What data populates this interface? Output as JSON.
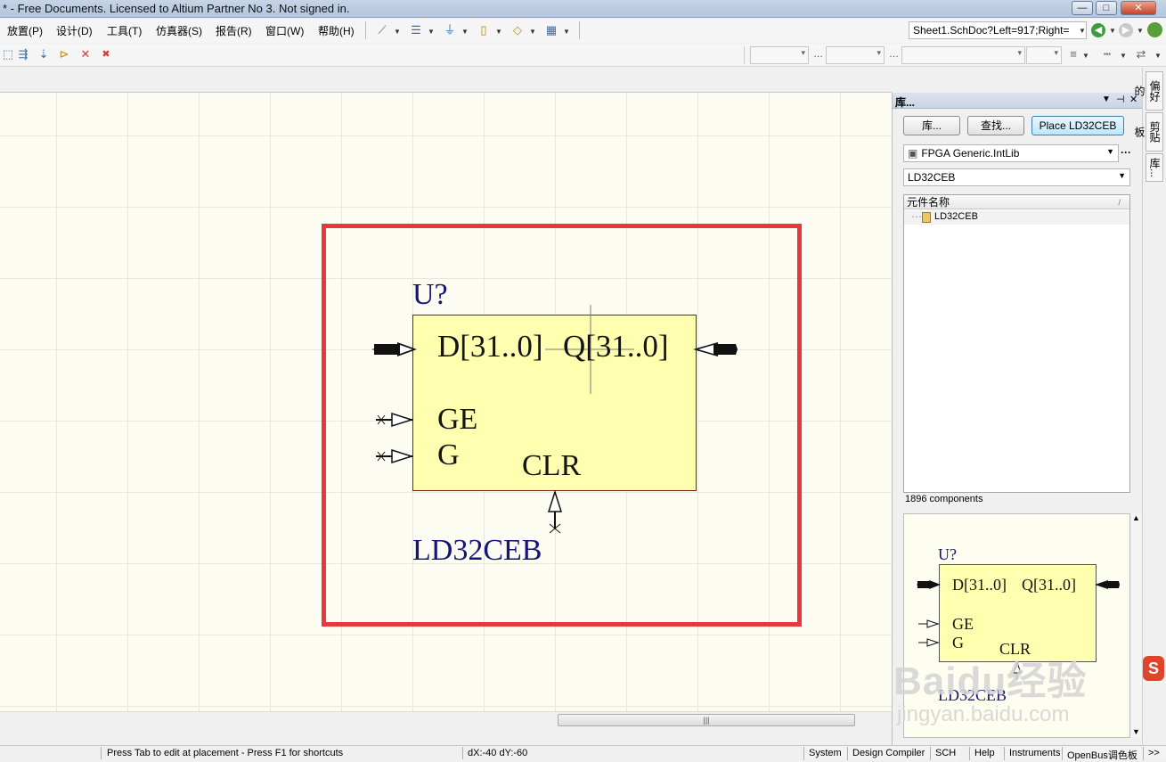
{
  "window": {
    "title": "* - Free Documents. Licensed to Altium Partner No 3. Not signed in.",
    "controls": {
      "minimize": "—",
      "maximize": "□",
      "close": "✕"
    }
  },
  "menu": {
    "items": [
      "放置(P)",
      "设计(D)",
      "工具(T)",
      "仿真器(S)",
      "报告(R)",
      "窗口(W)",
      "帮助(H)"
    ]
  },
  "navigation": {
    "location": "Sheet1.SchDoc?Left=917;Right="
  },
  "schematic": {
    "designator": "U?",
    "comment": "LD32CEB",
    "pins": {
      "d": "D[31..0]",
      "q": "Q[31..0]",
      "ge": "GE",
      "g": "G",
      "clr": "CLR"
    },
    "colors": {
      "body_fill": "#ffffb0",
      "body_border": "#7a1f1f",
      "highlight_frame": "#e8383d",
      "sheet_background": "#fdfcf3"
    }
  },
  "panel": {
    "title": "库...",
    "buttons": {
      "libraries": "库...",
      "search": "查找...",
      "place": "Place LD32CEB"
    },
    "library_name": "FPGA Generic.IntLib",
    "filter_value": "LD32CEB",
    "column_header": "元件名称",
    "components": [
      "LD32CEB"
    ],
    "count_text": "1896 components"
  },
  "side_tabs": [
    "偏好的",
    "剪贴板",
    "库..."
  ],
  "statusbar": {
    "message": "Press Tab to edit at placement - Press F1 for shortcuts",
    "coords": "dX:-40 dY:-60",
    "buttons": [
      "System",
      "Design Compiler",
      "SCH",
      "Help",
      "Instruments",
      "OpenBus调色板"
    ],
    "more": ">>"
  },
  "watermark": {
    "brand": "Baidu经验",
    "url": "jingyan.baidu.com"
  }
}
